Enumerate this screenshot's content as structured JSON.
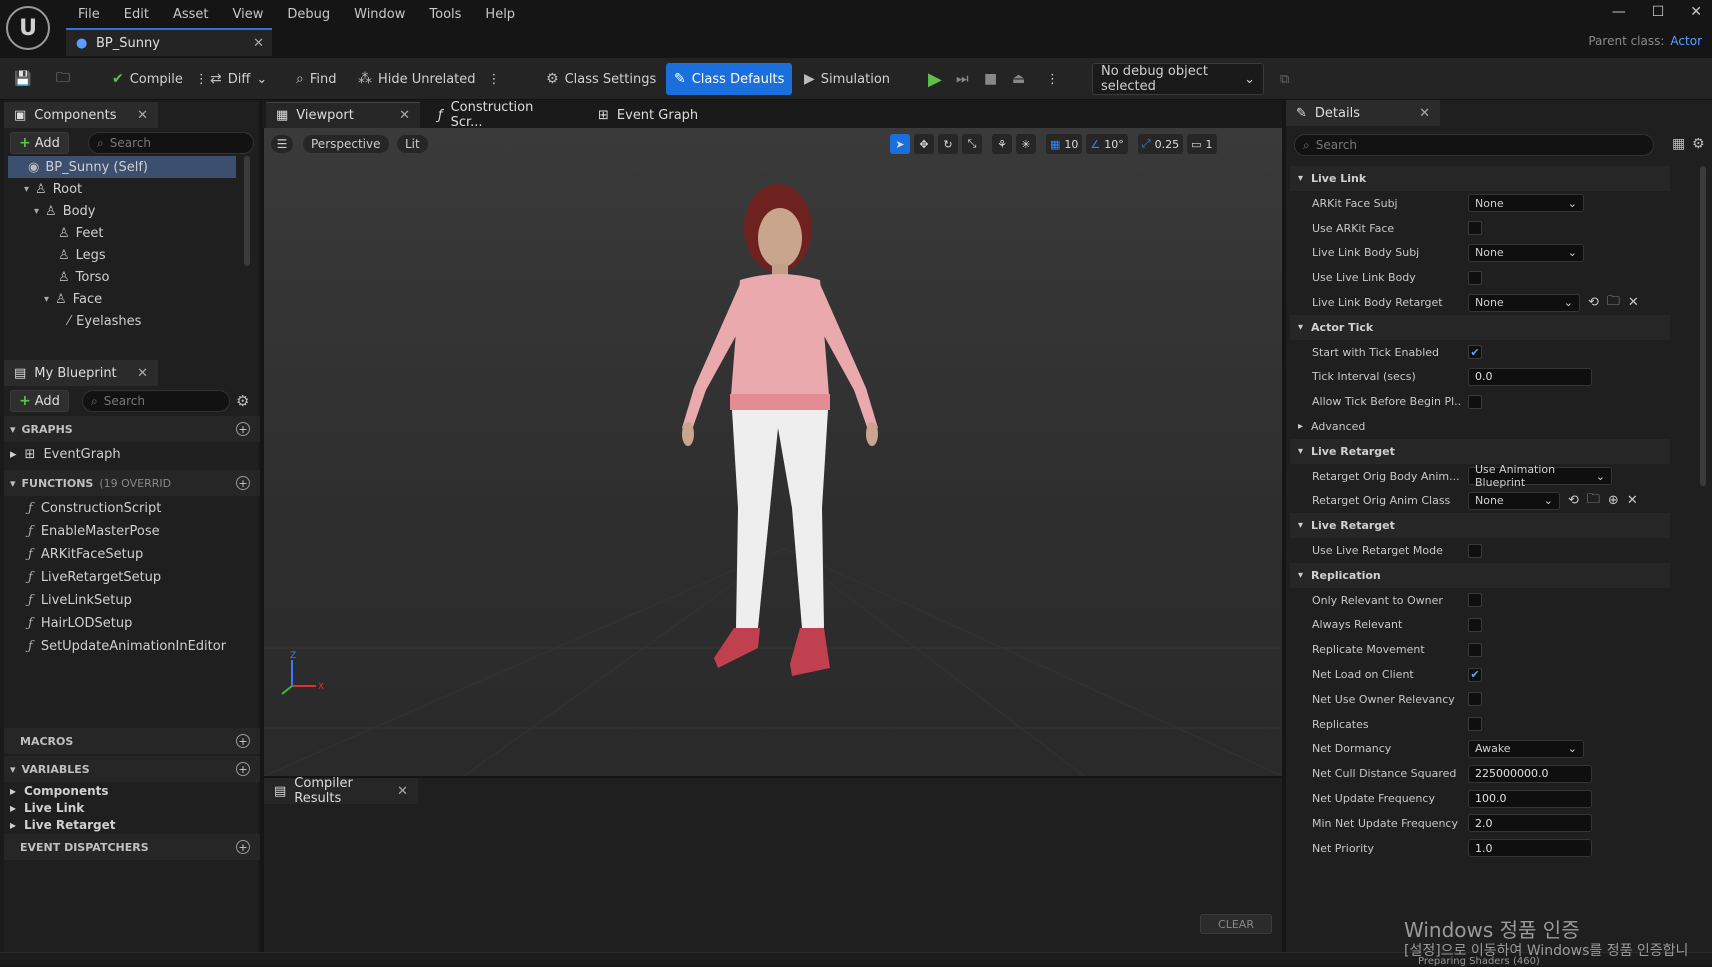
{
  "menu": [
    "File",
    "Edit",
    "Asset",
    "View",
    "Debug",
    "Window",
    "Tools",
    "Help"
  ],
  "document_tab": "BP_Sunny",
  "parent_class_label": "Parent class:",
  "parent_class_value": "Actor",
  "toolbar": {
    "compile": "Compile",
    "diff": "Diff",
    "find": "Find",
    "hide_unrelated": "Hide Unrelated",
    "class_settings": "Class Settings",
    "class_defaults": "Class Defaults",
    "simulation": "Simulation",
    "debug_object": "No debug object selected"
  },
  "components": {
    "tab": "Components",
    "add": "Add",
    "search_placeholder": "Search",
    "items": [
      {
        "label": "BP_Sunny (Self)",
        "level": 0,
        "selected": true
      },
      {
        "label": "Root",
        "level": 1,
        "expanded": true
      },
      {
        "label": "Body",
        "level": 2,
        "expanded": true
      },
      {
        "label": "Feet",
        "level": 3
      },
      {
        "label": "Legs",
        "level": 3
      },
      {
        "label": "Torso",
        "level": 3
      },
      {
        "label": "Face",
        "level": 3,
        "expanded": true
      },
      {
        "label": "Eyelashes",
        "level": 4
      }
    ]
  },
  "my_blueprint": {
    "tab": "My Blueprint",
    "add": "Add",
    "search_placeholder": "Search",
    "graphs_header": "GRAPHS",
    "graphs": [
      "EventGraph"
    ],
    "functions_header": "FUNCTIONS",
    "functions_note": "(19 OVERRID",
    "functions": [
      "ConstructionScript",
      "EnableMasterPose",
      "ARKitFaceSetup",
      "LiveRetargetSetup",
      "LiveLinkSetup",
      "HairLODSetup",
      "SetUpdateAnimationInEditor"
    ],
    "macros_header": "MACROS",
    "variables_header": "VARIABLES",
    "variables": [
      "Components",
      "Live Link",
      "Live Retarget"
    ],
    "dispatchers_header": "EVENT DISPATCHERS"
  },
  "editor_tabs": [
    "Viewport",
    "Construction Scr...",
    "Event Graph"
  ],
  "viewport": {
    "perspective": "Perspective",
    "lit": "Lit",
    "grid": "10",
    "angle": "10°",
    "scale": "0.25",
    "camera": "1",
    "axis_z": "Z",
    "axis_x": "X"
  },
  "compiler": {
    "tab": "Compiler Results",
    "clear": "CLEAR"
  },
  "details": {
    "tab": "Details",
    "search_placeholder": "Search",
    "rows": [
      {
        "t": "section",
        "label": "Live Link"
      },
      {
        "t": "dropdown",
        "label": "ARKit Face Subj",
        "value": "None"
      },
      {
        "t": "check",
        "label": "Use ARKit Face",
        "checked": false
      },
      {
        "t": "dropdown",
        "label": "Live Link Body Subj",
        "value": "None"
      },
      {
        "t": "check",
        "label": "Use Live Link Body",
        "checked": false
      },
      {
        "t": "dropdown-actions",
        "label": "Live Link Body Retarget",
        "value": "None"
      },
      {
        "t": "section",
        "label": "Actor Tick"
      },
      {
        "t": "check",
        "label": "Start with Tick Enabled",
        "checked": true
      },
      {
        "t": "text",
        "label": "Tick Interval (secs)",
        "value": "0.0"
      },
      {
        "t": "check",
        "label": "Allow Tick Before Begin Pl...",
        "checked": false
      },
      {
        "t": "sub",
        "label": "Advanced"
      },
      {
        "t": "section",
        "label": "Live Retarget"
      },
      {
        "t": "dropdown",
        "label": "Retarget Orig Body Anim...",
        "value": "Use Animation Blueprint"
      },
      {
        "t": "dropdown-actions2",
        "label": "Retarget Orig Anim Class",
        "value": "None"
      },
      {
        "t": "section",
        "label": "Live Retarget"
      },
      {
        "t": "check",
        "label": "Use Live Retarget Mode",
        "checked": false
      },
      {
        "t": "section",
        "label": "Replication"
      },
      {
        "t": "check",
        "label": "Only Relevant to Owner",
        "checked": false
      },
      {
        "t": "check",
        "label": "Always Relevant",
        "checked": false
      },
      {
        "t": "check",
        "label": "Replicate Movement",
        "checked": false
      },
      {
        "t": "check",
        "label": "Net Load on Client",
        "checked": true
      },
      {
        "t": "check",
        "label": "Net Use Owner Relevancy",
        "checked": false
      },
      {
        "t": "check",
        "label": "Replicates",
        "checked": false
      },
      {
        "t": "dropdown",
        "label": "Net Dormancy",
        "value": "Awake"
      },
      {
        "t": "text",
        "label": "Net Cull Distance Squared",
        "value": "225000000.0"
      },
      {
        "t": "text",
        "label": "Net Update Frequency",
        "value": "100.0"
      },
      {
        "t": "text",
        "label": "Min Net Update Frequency",
        "value": "2.0"
      },
      {
        "t": "text",
        "label": "Net Priority",
        "value": "1.0"
      }
    ]
  },
  "watermark": {
    "line1": "Windows 정품 인증",
    "line2": "[설정]으로 이동하여 Windows를 정품 인증합니",
    "line3": "Preparing Shaders (460)"
  },
  "colors": {
    "accent": "#1b6fdc",
    "play": "#5ec24a"
  }
}
